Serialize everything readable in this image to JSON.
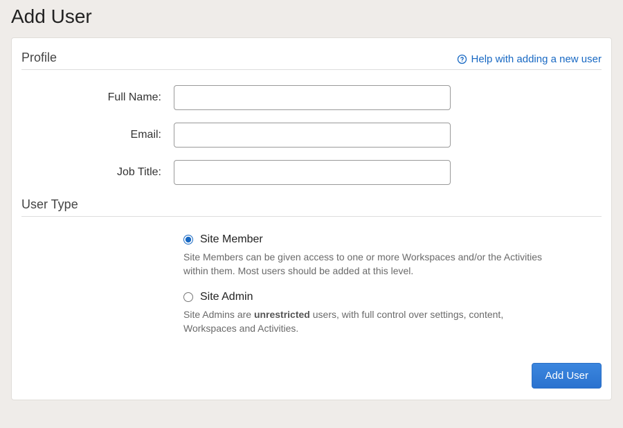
{
  "page_title": "Add User",
  "sections": {
    "profile": {
      "title": "Profile",
      "help_link": "Help with adding a new user",
      "fields": {
        "full_name": {
          "label": "Full Name:",
          "value": ""
        },
        "email": {
          "label": "Email:",
          "value": ""
        },
        "job_title": {
          "label": "Job Title:",
          "value": ""
        }
      }
    },
    "user_type": {
      "title": "User Type",
      "options": {
        "member": {
          "label": "Site Member",
          "checked": true,
          "desc": "Site Members can be given access to one or more Workspaces and/or the Activities within them. Most users should be added at this level."
        },
        "admin": {
          "label": "Site Admin",
          "checked": false,
          "desc_pre": "Site Admins are ",
          "desc_bold": "unrestricted",
          "desc_post": " users, with full control over settings, content, Workspaces and Activities."
        }
      }
    }
  },
  "buttons": {
    "submit": "Add User"
  }
}
